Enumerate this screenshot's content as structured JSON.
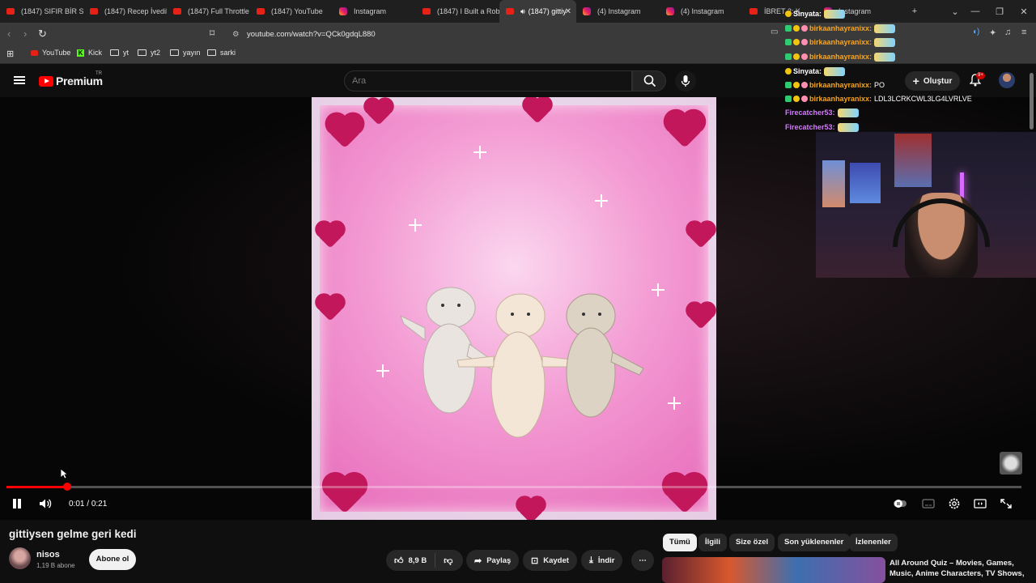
{
  "browser": {
    "tabs": [
      {
        "icon": "youtube",
        "label": "(1847) SIFIR BİR SE"
      },
      {
        "icon": "youtube",
        "label": "(1847) Recep İvedik"
      },
      {
        "icon": "youtube",
        "label": "(1847) Full Throttle"
      },
      {
        "icon": "youtube",
        "label": "(1847) YouTube"
      },
      {
        "icon": "instagram",
        "label": "Instagram"
      },
      {
        "icon": "youtube",
        "label": "(1847) I Built a Rob"
      },
      {
        "icon": "youtube",
        "label": "(1847) gittiy"
      },
      {
        "icon": "instagram",
        "label": "(4) Instagram"
      },
      {
        "icon": "instagram",
        "label": "(4) Instagram"
      },
      {
        "icon": "youtube",
        "label": "İBRET 2: K"
      },
      {
        "icon": "instagram",
        "label": "Instagram"
      }
    ],
    "new_tab": "+",
    "url": "youtube.com/watch?v=QCk0gdqL880",
    "bookmarks": [
      {
        "icon": "youtube",
        "label": "YouTube"
      },
      {
        "icon": "kick",
        "label": "Kick"
      },
      {
        "icon": "folder",
        "label": "yt"
      },
      {
        "icon": "folder",
        "label": "yt2"
      },
      {
        "icon": "folder",
        "label": "yayın"
      },
      {
        "icon": "folder",
        "label": "sarki"
      }
    ]
  },
  "youtube": {
    "logo": "Premium",
    "region": "TR",
    "search_placeholder": "Ara",
    "create_label": "Oluştur",
    "notifications": "9+"
  },
  "video": {
    "current_time": "0:01",
    "duration": "0:21",
    "progress": 0.06,
    "title": "gittiysen gelme geri kedi",
    "channel": "nisos",
    "subscribers": "1,19 B abone",
    "subscribe_label": "Abone ol",
    "likes": "8,9 B",
    "share_label": "Paylaş",
    "save_label": "Kaydet",
    "download_label": "İndir"
  },
  "chips": [
    "Tümü",
    "İlgili",
    "Size özel",
    "Son yüklenenler",
    "İzlenenler"
  ],
  "recommendation": {
    "title": "All Around Quiz – Movies, Games, Music, Anime Characters, TV Shows,"
  },
  "chat": [
    {
      "name": "Sinyata:",
      "color": "white",
      "msg": ""
    },
    {
      "name": "birkaanhayranixx:",
      "color": "orange",
      "msg": ""
    },
    {
      "name": "birkaanhayranixx:",
      "color": "orange",
      "msg": ""
    },
    {
      "name": "birkaanhayranixx:",
      "color": "orange",
      "msg": ""
    },
    {
      "name": "Sinyata:",
      "color": "white",
      "msg": ""
    },
    {
      "name": "birkaanhayranixx:",
      "color": "orange",
      "msg": "PO"
    },
    {
      "name": "birkaanhayranixx:",
      "color": "orange",
      "msg": "LDL3LCRKCWL3LG4LVRLVE"
    },
    {
      "name": "Firecatcher53:",
      "color": "purple",
      "msg": ""
    },
    {
      "name": "Firecatcher53:",
      "color": "purple",
      "msg": ""
    }
  ]
}
